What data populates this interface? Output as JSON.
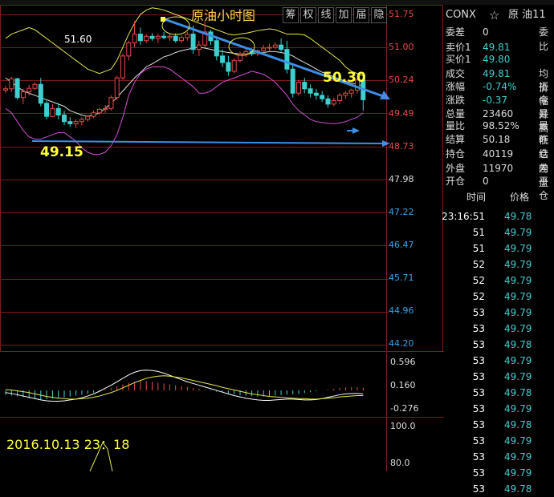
{
  "chart_data": {
    "type": "candlestick",
    "title": "原油小时图",
    "toolbar": [
      "筹",
      "权",
      "线",
      "加",
      "届",
      "隐"
    ],
    "price_axis": {
      "ticks": [
        "51.75",
        "51.00",
        "50.24",
        "49.49",
        "48.73",
        "47.98",
        "47.22",
        "46.47",
        "45.71",
        "44.96",
        "44.20"
      ],
      "ylim": [
        44.2,
        51.75
      ]
    },
    "annotations": {
      "high": "51.60",
      "low": "49.15",
      "current": "50.30"
    },
    "candles": [
      [
        50.02,
        50.12,
        49.95,
        50.05
      ],
      [
        50.05,
        50.32,
        49.98,
        50.28
      ],
      [
        50.28,
        50.3,
        49.8,
        49.85
      ],
      [
        49.85,
        50.05,
        49.7,
        49.98
      ],
      [
        49.98,
        50.14,
        49.9,
        50.06
      ],
      [
        50.06,
        50.2,
        50.02,
        50.15
      ],
      [
        50.15,
        50.3,
        49.65,
        49.72
      ],
      [
        49.72,
        49.78,
        49.35,
        49.42
      ],
      [
        49.42,
        49.7,
        49.4,
        49.6
      ],
      [
        49.6,
        49.72,
        49.35,
        49.45
      ],
      [
        49.45,
        49.55,
        49.22,
        49.3
      ],
      [
        49.3,
        49.4,
        49.18,
        49.25
      ],
      [
        49.25,
        49.35,
        49.15,
        49.3
      ],
      [
        49.3,
        49.4,
        49.22,
        49.35
      ],
      [
        49.35,
        49.45,
        49.3,
        49.42
      ],
      [
        49.42,
        49.55,
        49.38,
        49.5
      ],
      [
        49.5,
        49.62,
        49.45,
        49.58
      ],
      [
        49.58,
        49.68,
        49.5,
        49.6
      ],
      [
        49.6,
        49.9,
        49.55,
        49.85
      ],
      [
        49.85,
        50.35,
        49.8,
        50.3
      ],
      [
        50.3,
        50.85,
        50.25,
        50.8
      ],
      [
        50.8,
        51.15,
        50.7,
        51.1
      ],
      [
        51.1,
        51.6,
        51.0,
        51.3
      ],
      [
        51.3,
        51.45,
        51.05,
        51.15
      ],
      [
        51.15,
        51.3,
        51.1,
        51.25
      ],
      [
        51.25,
        51.32,
        51.15,
        51.2
      ],
      [
        51.2,
        51.3,
        51.1,
        51.25
      ],
      [
        51.25,
        51.35,
        51.18,
        51.22
      ],
      [
        51.22,
        51.3,
        51.15,
        51.25
      ],
      [
        51.25,
        51.32,
        51.1,
        51.15
      ],
      [
        51.15,
        51.28,
        51.1,
        51.22
      ],
      [
        51.22,
        51.35,
        51.15,
        51.3
      ],
      [
        51.3,
        51.5,
        50.85,
        50.95
      ],
      [
        50.95,
        51.15,
        50.8,
        51.05
      ],
      [
        51.05,
        51.6,
        51.0,
        51.35
      ],
      [
        51.35,
        51.4,
        51.05,
        51.15
      ],
      [
        51.15,
        51.25,
        50.7,
        50.8
      ],
      [
        50.8,
        50.95,
        50.55,
        50.65
      ],
      [
        50.65,
        50.8,
        50.35,
        50.45
      ],
      [
        50.45,
        50.75,
        50.4,
        50.7
      ],
      [
        50.7,
        50.9,
        50.65,
        50.85
      ],
      [
        50.85,
        50.95,
        50.78,
        50.9
      ],
      [
        50.9,
        50.98,
        50.8,
        50.85
      ],
      [
        50.85,
        50.95,
        50.8,
        50.92
      ],
      [
        50.92,
        51.05,
        50.85,
        50.98
      ],
      [
        50.98,
        51.08,
        50.9,
        51.0
      ],
      [
        51.0,
        51.12,
        50.95,
        51.05
      ],
      [
        51.05,
        51.2,
        50.9,
        50.95
      ],
      [
        50.95,
        51.15,
        50.4,
        50.5
      ],
      [
        50.5,
        50.6,
        49.85,
        49.95
      ],
      [
        49.95,
        50.25,
        49.9,
        50.2
      ],
      [
        50.2,
        50.3,
        49.95,
        50.05
      ],
      [
        50.05,
        50.15,
        49.85,
        49.95
      ],
      [
        49.95,
        50.05,
        49.8,
        49.9
      ],
      [
        49.9,
        50.0,
        49.75,
        49.82
      ],
      [
        49.82,
        49.9,
        49.62,
        49.7
      ],
      [
        49.7,
        49.85,
        49.65,
        49.78
      ],
      [
        49.78,
        49.95,
        49.7,
        49.9
      ],
      [
        49.9,
        50.0,
        49.82,
        49.95
      ],
      [
        49.95,
        50.05,
        49.85,
        50.02
      ],
      [
        50.02,
        50.3,
        49.95,
        50.25
      ],
      [
        50.25,
        50.4,
        49.55,
        49.8
      ]
    ],
    "bollinger": {
      "upper": [
        51.2,
        51.3,
        51.35,
        51.4,
        51.45,
        51.4,
        51.3,
        51.2,
        51.1,
        51.0,
        50.9,
        50.8,
        50.7,
        50.6,
        50.5,
        50.45,
        50.4,
        50.45,
        50.5,
        50.7,
        51.0,
        51.3,
        51.55,
        51.75,
        51.85,
        51.9,
        51.88,
        51.85,
        51.8,
        51.75,
        51.7,
        51.65,
        51.6,
        51.55,
        51.5,
        51.45,
        51.4,
        51.35,
        51.3,
        51.28,
        51.3,
        51.32,
        51.35,
        51.38,
        51.4,
        51.42,
        51.4,
        51.35,
        51.3,
        51.3,
        51.3,
        51.28,
        51.2,
        51.1,
        51.0,
        50.9,
        50.8,
        50.7,
        50.55,
        50.45,
        50.4,
        50.35
      ],
      "middle": [
        50.3,
        50.2,
        50.1,
        50.0,
        49.95,
        49.9,
        49.85,
        49.8,
        49.75,
        49.7,
        49.65,
        49.55,
        49.5,
        49.45,
        49.42,
        49.45,
        49.5,
        49.6,
        49.72,
        49.85,
        50.0,
        50.15,
        50.3,
        50.42,
        50.55,
        50.62,
        50.7,
        50.78,
        50.82,
        50.88,
        50.92,
        50.95,
        50.98,
        51.0,
        50.98,
        50.95,
        50.92,
        50.9,
        50.88,
        50.86,
        50.85,
        50.85,
        50.86,
        50.87,
        50.88,
        50.9,
        50.9,
        50.88,
        50.85,
        50.8,
        50.72,
        50.65,
        50.58,
        50.5,
        50.43,
        50.38,
        50.32,
        50.27,
        50.22,
        50.18,
        50.15,
        50.12
      ],
      "lower": [
        49.6,
        49.5,
        49.3,
        49.1,
        48.95,
        48.9,
        48.9,
        48.95,
        49.0,
        49.05,
        49.05,
        48.95,
        48.85,
        48.7,
        48.6,
        48.55,
        48.55,
        48.6,
        48.75,
        49.0,
        49.4,
        49.9,
        50.2,
        50.4,
        50.5,
        50.55,
        50.55,
        50.55,
        50.5,
        50.4,
        50.3,
        50.2,
        50.1,
        49.95,
        49.95,
        50.0,
        50.1,
        50.2,
        50.25,
        50.3,
        50.35,
        50.4,
        50.45,
        50.42,
        50.38,
        50.3,
        50.2,
        50.05,
        49.9,
        49.7,
        49.55,
        49.45,
        49.35,
        49.3,
        49.28,
        49.26,
        49.25,
        49.27,
        49.3,
        49.35,
        49.4,
        49.5
      ]
    },
    "macd": {
      "axis_ticks": [
        "0.596",
        "0.160",
        "-0.276"
      ],
      "ylim": [
        -0.5,
        0.65
      ],
      "hist": [
        -0.1,
        -0.12,
        -0.14,
        -0.16,
        -0.18,
        -0.2,
        -0.21,
        -0.2,
        -0.19,
        -0.18,
        -0.16,
        -0.14,
        -0.12,
        -0.1,
        -0.08,
        -0.05,
        -0.02,
        0.02,
        0.06,
        0.1,
        0.14,
        0.18,
        0.2,
        0.22,
        0.21,
        0.2,
        0.18,
        0.16,
        0.14,
        0.12,
        0.1,
        0.08,
        0.06,
        0.04,
        0.02,
        -0.01,
        -0.03,
        -0.05,
        -0.07,
        -0.09,
        -0.11,
        -0.12,
        -0.13,
        -0.14,
        -0.14,
        -0.13,
        -0.12,
        -0.11,
        -0.1,
        -0.09,
        -0.08,
        -0.06,
        -0.04,
        -0.02,
        0.0,
        0.02,
        0.04,
        0.06,
        0.07,
        0.08,
        0.07,
        0.06
      ],
      "dif": [
        -0.05,
        -0.07,
        -0.1,
        -0.13,
        -0.16,
        -0.19,
        -0.22,
        -0.24,
        -0.25,
        -0.25,
        -0.24,
        -0.22,
        -0.2,
        -0.17,
        -0.13,
        -0.08,
        -0.02,
        0.05,
        0.12,
        0.2,
        0.28,
        0.36,
        0.42,
        0.46,
        0.47,
        0.46,
        0.44,
        0.4,
        0.35,
        0.3,
        0.25,
        0.2,
        0.16,
        0.12,
        0.08,
        0.04,
        0.0,
        -0.04,
        -0.08,
        -0.12,
        -0.15,
        -0.18,
        -0.2,
        -0.22,
        -0.23,
        -0.23,
        -0.22,
        -0.21,
        -0.2,
        -0.2,
        -0.21,
        -0.22,
        -0.22,
        -0.21,
        -0.19,
        -0.16,
        -0.13,
        -0.1,
        -0.08,
        -0.07,
        -0.07,
        -0.08
      ],
      "dea": [
        0.02,
        0.01,
        -0.01,
        -0.03,
        -0.05,
        -0.08,
        -0.11,
        -0.14,
        -0.16,
        -0.18,
        -0.19,
        -0.2,
        -0.2,
        -0.19,
        -0.18,
        -0.16,
        -0.13,
        -0.09,
        -0.05,
        0.0,
        0.06,
        0.12,
        0.18,
        0.23,
        0.28,
        0.31,
        0.33,
        0.34,
        0.33,
        0.31,
        0.29,
        0.26,
        0.23,
        0.2,
        0.17,
        0.14,
        0.11,
        0.07,
        0.04,
        0.01,
        -0.02,
        -0.05,
        -0.08,
        -0.1,
        -0.12,
        -0.14,
        -0.15,
        -0.16,
        -0.17,
        -0.18,
        -0.19,
        -0.19,
        -0.2,
        -0.2,
        -0.19,
        -0.18,
        -0.17,
        -0.15,
        -0.14,
        -0.13,
        -0.12,
        -0.12
      ]
    },
    "volume": {
      "axis_ticks": [
        "100.0",
        "80.0"
      ],
      "timestamp": "2016.10.13 23：18"
    }
  },
  "quote_panel": {
    "symbol": "CONX",
    "star": "☆",
    "name": "原 油11",
    "rows": [
      {
        "label": "委差",
        "value": "0",
        "tail": "委比",
        "color": "#dddddd"
      },
      {
        "label": "卖价1",
        "value": "49.81",
        "tail": "",
        "color": "#3ed0d0"
      },
      {
        "label": "买价1",
        "value": "49.80",
        "tail": "",
        "color": "#3ed0d0"
      },
      {
        "label": "成交",
        "value": "49.81",
        "tail": "均价",
        "color": "#3ed0d0"
      },
      {
        "label": "涨幅",
        "value": "-0.74%",
        "tail": "振幅",
        "color": "#3ed0d0"
      },
      {
        "label": "涨跌",
        "value": "-0.37",
        "tail": "今开",
        "color": "#3ed0d0"
      },
      {
        "label": "总量",
        "value": "23460",
        "tail": "最高",
        "color": "#dddddd"
      },
      {
        "label": "量比",
        "value": "98.52%",
        "tail": "最低",
        "color": "#dddddd"
      },
      {
        "label": "结算",
        "value": "50.18",
        "tail": "昨结",
        "color": "#dddddd"
      },
      {
        "label": "持仓",
        "value": "40119",
        "tail": "仓差",
        "color": "#dddddd"
      },
      {
        "label": "外盘",
        "value": "11970",
        "tail": "内盘",
        "color": "#dddddd"
      },
      {
        "label": "开仓",
        "value": "0",
        "tail": "平仓",
        "color": "#dddddd"
      }
    ],
    "tick_header": {
      "time": "时间",
      "price": "价格"
    },
    "ticks": [
      {
        "time": "23:16:51",
        "price": "49.78"
      },
      {
        "time": "51",
        "price": "49.79"
      },
      {
        "time": "51",
        "price": "49.79"
      },
      {
        "time": "52",
        "price": "49.79"
      },
      {
        "time": "52",
        "price": "49.79"
      },
      {
        "time": "52",
        "price": "49.79"
      },
      {
        "time": "53",
        "price": "49.79"
      },
      {
        "time": "53",
        "price": "49.79"
      },
      {
        "time": "53",
        "price": "49.78"
      },
      {
        "time": "53",
        "price": "49.79"
      },
      {
        "time": "53",
        "price": "49.79"
      },
      {
        "time": "53",
        "price": "49.78"
      },
      {
        "time": "53",
        "price": "49.79"
      },
      {
        "time": "53",
        "price": "49.78"
      },
      {
        "time": "53",
        "price": "49.79"
      },
      {
        "time": "53",
        "price": "49.79"
      },
      {
        "time": "53",
        "price": "49.79"
      },
      {
        "time": "53",
        "price": "49.78"
      }
    ]
  },
  "colors": {
    "up": "#e84a4a",
    "down": "#3ed0d0",
    "bb_upper": "#e8e84a",
    "bb_middle": "#e0e0e0",
    "bb_lower": "#d44fd4",
    "arrow": "#3c8fe6",
    "grid": "#7a1c1c"
  }
}
